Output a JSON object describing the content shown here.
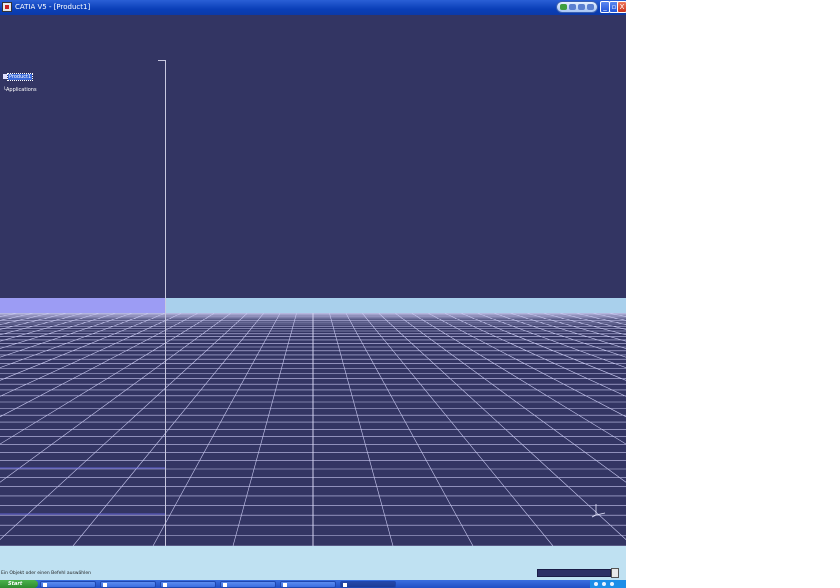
{
  "window": {
    "title": "CATIA V5 - [Product1]",
    "buttons": {
      "minimize": "_",
      "restore": "▫",
      "close": "X"
    },
    "status_pill_icons": [
      "help-icon",
      "search-icon",
      "layout-icon",
      "info-icon"
    ]
  },
  "tree": {
    "root_label": "Product1",
    "child_label": "Applications"
  },
  "status": {
    "message": "Ein Objekt oder einen Befehl auswählen",
    "command_input_value": ""
  },
  "taskbar": {
    "start_label": "Start",
    "tasks": [
      {
        "label": ""
      },
      {
        "label": ""
      },
      {
        "label": ""
      },
      {
        "label": ""
      },
      {
        "label": ""
      },
      {
        "label": ""
      }
    ],
    "active_task_index": 5
  },
  "colors": {
    "viewport_background": "#333563",
    "horizon": "#a9d0ec",
    "grid_line": "#c8c8f0",
    "title_bar": "#0a3fb8",
    "taskbar": "#245edb",
    "start_button": "#3a9e3a"
  }
}
